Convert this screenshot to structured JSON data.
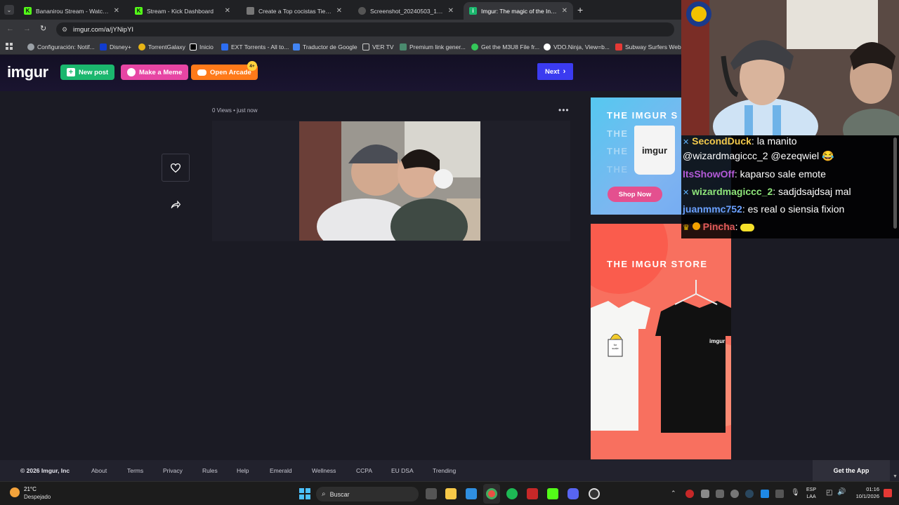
{
  "browser": {
    "tabs": [
      {
        "title": "Bananirou Stream - Watch Live",
        "favicon_color": "#53fc18",
        "active": false
      },
      {
        "title": "Stream - Kick Dashboard",
        "favicon_color": "#53fc18",
        "active": false
      },
      {
        "title": "Create a Top cocistas Tier List -",
        "favicon_color": "#888888",
        "active": false
      },
      {
        "title": "Screenshot_20240503_155733",
        "favicon_color": "#888888",
        "active": false
      },
      {
        "title": "Imgur: The magic of the Interne",
        "favicon_color": "#1bb76e",
        "active": true
      }
    ],
    "new_tab_label": "+",
    "url": "imgur.com/a/jYNipYI",
    "bookmarks": [
      {
        "label": "Configuración: Notif...",
        "icon_color": "#9aa0a6"
      },
      {
        "label": "Disney+",
        "icon_color": "#113ccf"
      },
      {
        "label": "TorrentGalaxy",
        "icon_color": "#e7b416"
      },
      {
        "label": "Inicio",
        "icon_color": "#ffffff"
      },
      {
        "label": "EXT Torrents - All to...",
        "icon_color": "#2c6df1"
      },
      {
        "label": "Traductor de Google",
        "icon_color": "#4285f4"
      },
      {
        "label": "VER TV",
        "icon_color": "#9aa0a6"
      },
      {
        "label": "Premium link gener...",
        "icon_color": "#4a8a6e"
      },
      {
        "label": "Get the M3U8 File fr...",
        "icon_color": "#34c759"
      },
      {
        "label": "VDO.Ninja, View=b...",
        "icon_color": "#ffffff"
      },
      {
        "label": "Subway Surfers Web",
        "icon_color": "#e53935"
      }
    ]
  },
  "imgur": {
    "logo": "imgur",
    "new_post_label": "New post",
    "make_meme_label": "Make a Meme",
    "open_arcade_label": "Open Arcade",
    "arcade_badge": "4+",
    "next_label": "Next",
    "post_views": "0 Views",
    "post_time": "just now",
    "ad1": {
      "title_lines": [
        "THE IMGUR S",
        "THE",
        "THE",
        "THE"
      ],
      "mug_logo": "imgur",
      "cta": "Shop Now"
    },
    "ad2": {
      "title": "THE IMGUR STORE",
      "shirt_logo": "imgur",
      "tag_text": "for scale"
    },
    "footer": {
      "copyright": "© 2026 Imgur, Inc",
      "links": [
        "About",
        "Terms",
        "Privacy",
        "Rules",
        "Help",
        "Emerald",
        "Wellness",
        "CCPA",
        "EU DSA",
        "Trending"
      ],
      "get_app": "Get the App"
    }
  },
  "chat": [
    {
      "user": "SecondDuck",
      "color": "#f2c94c",
      "text": ": la manito",
      "verified": true
    },
    {
      "user": "",
      "color": "#ffffff",
      "text": "@wizardmagiccc_2 @ezeqwiel 😂",
      "verified": false
    },
    {
      "user": "ItsShowOff",
      "color": "#b35ad8",
      "text": ": kaparso sale emote",
      "verified": false
    },
    {
      "user": "wizardmagiccc_2",
      "color": "#8ee57a",
      "text": ": sadjdsajdsaj mal",
      "verified": true
    },
    {
      "user": "juanmmc752",
      "color": "#6aa0ff",
      "text": ": es real o siensia fixion",
      "verified": false
    },
    {
      "user": "Pincha",
      "color": "#e05a5a",
      "text": ":",
      "verified": false
    }
  ],
  "taskbar": {
    "weather_temp": "21°C",
    "weather_desc": "Despejado",
    "search_placeholder": "Buscar",
    "lang_top": "ESP",
    "lang_bottom": "LAA",
    "time": "01:16",
    "date": "10/1/2026"
  },
  "colors": {
    "new_post": "#1bb76e",
    "make_meme": "#e745a4",
    "open_arcade": "#ff7a1a",
    "next": "#3b3bf0"
  }
}
